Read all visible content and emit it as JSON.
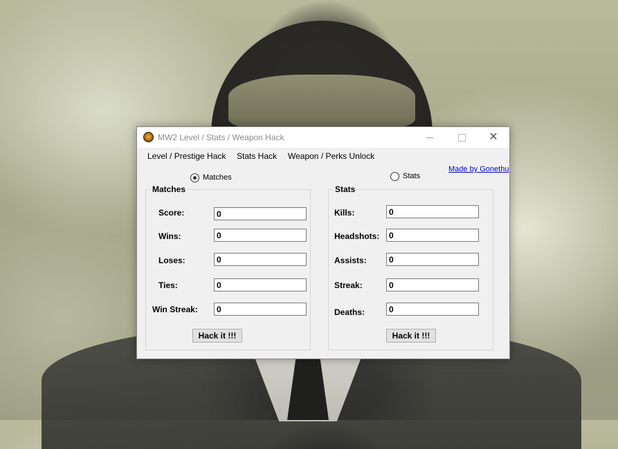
{
  "window": {
    "title": "MW2 Level / Stats / Weapon Hack",
    "controls": {
      "minimize": "",
      "maximize": "",
      "close": "✕"
    }
  },
  "menu": {
    "items": [
      "Level / Prestige Hack",
      "Stats Hack",
      "Weapon / Perks Unlock"
    ]
  },
  "credit_link": "Made by Gonethu",
  "radios": {
    "matches": {
      "label": "Matches",
      "checked": true
    },
    "stats": {
      "label": "Stats",
      "checked": false
    }
  },
  "matches_group": {
    "title": "Matches",
    "fields": [
      {
        "label": "Score:",
        "value": "0"
      },
      {
        "label": "Wins:",
        "value": "0"
      },
      {
        "label": "Loses:",
        "value": "0"
      },
      {
        "label": "Ties:",
        "value": "0"
      },
      {
        "label": "Win Streak:",
        "value": "0"
      }
    ],
    "button": "Hack it !!!"
  },
  "stats_group": {
    "title": "Stats",
    "fields": [
      {
        "label": "Kills:",
        "value": "0"
      },
      {
        "label": "Headshots:",
        "value": "0"
      },
      {
        "label": "Assists:",
        "value": "0"
      },
      {
        "label": "Streak:",
        "value": "0"
      },
      {
        "label": "Deaths:",
        "value": "0"
      }
    ],
    "button": "Hack it !!!"
  },
  "icons": {
    "app": "mw2-emblem-icon",
    "minimize": "minimize-icon",
    "maximize": "maximize-icon",
    "close": "close-icon"
  }
}
